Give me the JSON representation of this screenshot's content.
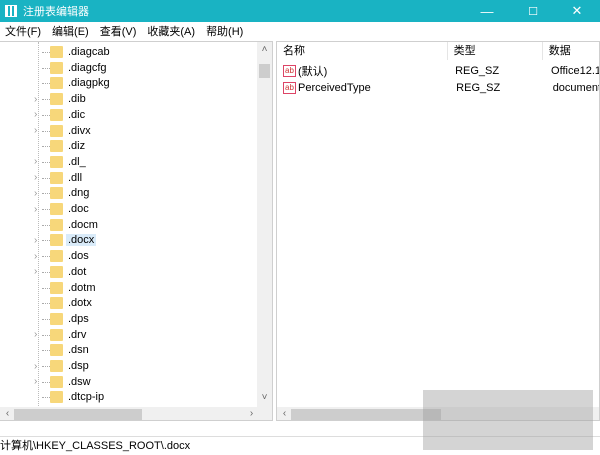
{
  "window": {
    "title": "注册表编辑器",
    "minimize": "—",
    "maximize": "☐",
    "close": "✕"
  },
  "menu": [
    "文件(F)",
    "编辑(E)",
    "查看(V)",
    "收藏夹(A)",
    "帮助(H)"
  ],
  "tree": [
    {
      "label": ".diagcab",
      "expandable": false
    },
    {
      "label": ".diagcfg",
      "expandable": false
    },
    {
      "label": ".diagpkg",
      "expandable": false
    },
    {
      "label": ".dib",
      "expandable": true
    },
    {
      "label": ".dic",
      "expandable": true
    },
    {
      "label": ".divx",
      "expandable": true
    },
    {
      "label": ".diz",
      "expandable": false
    },
    {
      "label": ".dl_",
      "expandable": true
    },
    {
      "label": ".dll",
      "expandable": true
    },
    {
      "label": ".dng",
      "expandable": true
    },
    {
      "label": ".doc",
      "expandable": true
    },
    {
      "label": ".docm",
      "expandable": false
    },
    {
      "label": ".docx",
      "expandable": true,
      "selected": true
    },
    {
      "label": ".dos",
      "expandable": true
    },
    {
      "label": ".dot",
      "expandable": true
    },
    {
      "label": ".dotm",
      "expandable": false
    },
    {
      "label": ".dotx",
      "expandable": false
    },
    {
      "label": ".dps",
      "expandable": false
    },
    {
      "label": ".drv",
      "expandable": true
    },
    {
      "label": ".dsn",
      "expandable": false
    },
    {
      "label": ".dsp",
      "expandable": true
    },
    {
      "label": ".dsw",
      "expandable": true
    },
    {
      "label": ".dtcp-ip",
      "expandable": false
    }
  ],
  "values": {
    "headers": {
      "name": "名称",
      "type": "类型",
      "data": "数据"
    },
    "rows": [
      {
        "name": "(默认)",
        "type": "REG_SZ",
        "data": "Office12.1"
      },
      {
        "name": "PerceivedType",
        "type": "REG_SZ",
        "data": "document"
      }
    ],
    "icon": "ab"
  },
  "status": "计算机\\HKEY_CLASSES_ROOT\\.docx"
}
